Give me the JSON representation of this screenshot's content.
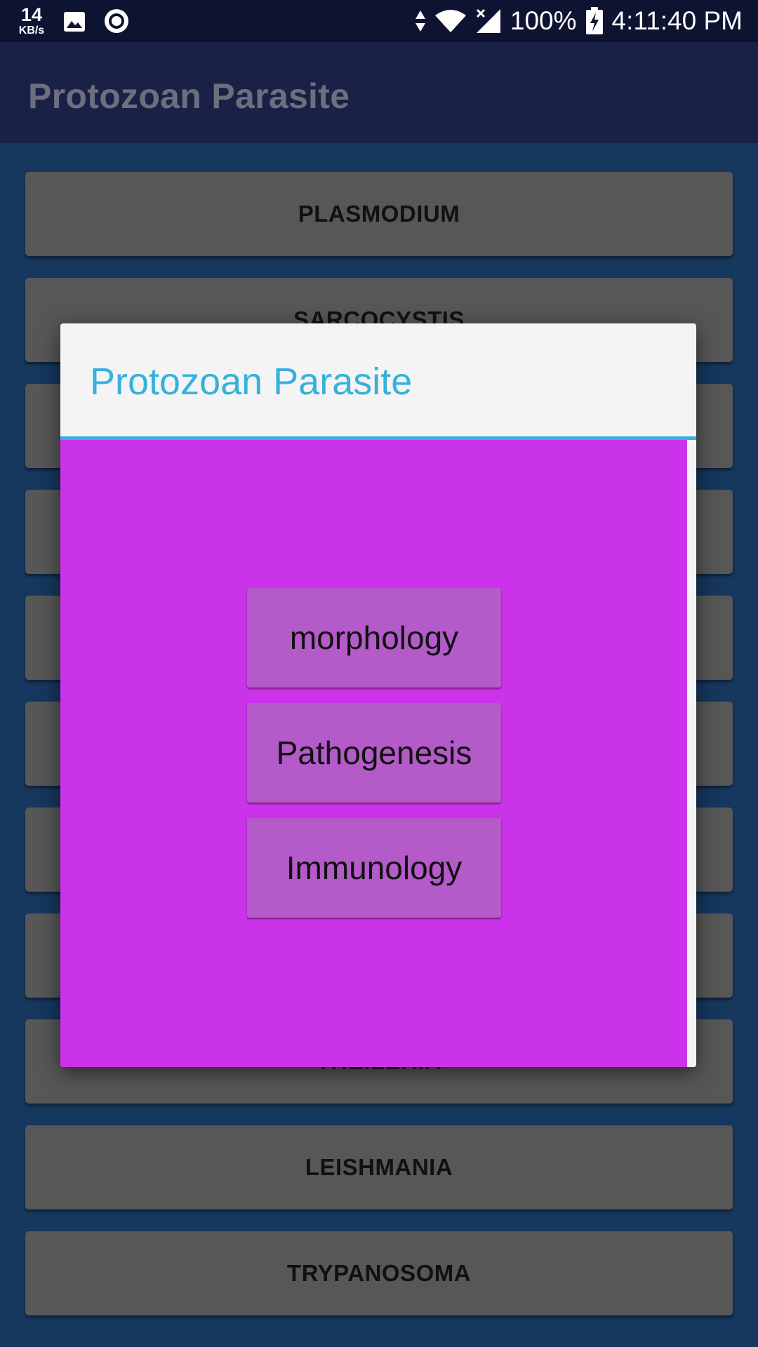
{
  "status_bar": {
    "net_speed_value": "14",
    "net_speed_unit": "KB/s",
    "battery": "100%",
    "time": "4:11:40 PM",
    "icons": [
      "image-icon",
      "record-icon",
      "data-arrows-icon",
      "wifi-icon",
      "signal-icon",
      "battery-charging-icon"
    ]
  },
  "app_bar": {
    "title": "Protozoan Parasite"
  },
  "list": {
    "items": [
      {
        "label": "PLASMODIUM"
      },
      {
        "label": "SARCOCYSTIS"
      },
      {
        "label": ""
      },
      {
        "label": ""
      },
      {
        "label": ""
      },
      {
        "label": ""
      },
      {
        "label": ""
      },
      {
        "label": ""
      },
      {
        "label": "THEILERIA"
      },
      {
        "label": "LEISHMANIA"
      },
      {
        "label": "TRYPANOSOMA"
      }
    ]
  },
  "dialog": {
    "title": "Protozoan Parasite",
    "options": [
      {
        "label": "morphology"
      },
      {
        "label": "Pathogenesis"
      },
      {
        "label": "Immunology"
      }
    ],
    "colors": {
      "title": "#36b1dd",
      "body": "#cb33ea",
      "option": "#b45ac9"
    }
  }
}
